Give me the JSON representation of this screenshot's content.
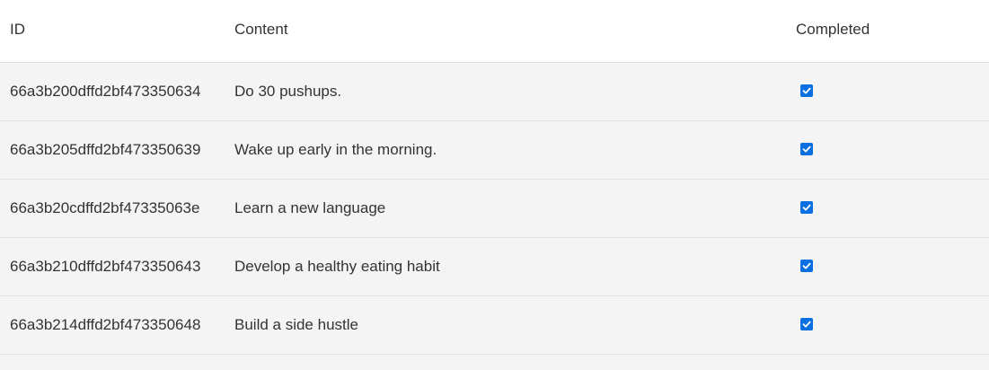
{
  "table": {
    "headers": {
      "id": "ID",
      "content": "Content",
      "completed": "Completed"
    },
    "rows": [
      {
        "id": "66a3b200dffd2bf473350634",
        "content": "Do 30 pushups.",
        "completed": true
      },
      {
        "id": "66a3b205dffd2bf473350639",
        "content": "Wake up early in the morning.",
        "completed": true
      },
      {
        "id": "66a3b20cdffd2bf47335063e",
        "content": "Learn a new language",
        "completed": true
      },
      {
        "id": "66a3b210dffd2bf473350643",
        "content": "Develop a healthy eating habit",
        "completed": true
      },
      {
        "id": "66a3b214dffd2bf473350648",
        "content": "Build a side hustle",
        "completed": true
      }
    ]
  },
  "icons": {
    "checkbox": "checkmark-icon"
  },
  "colors": {
    "checkbox_fill": "#0a6fe0",
    "row_background": "#f4f4f4",
    "header_background": "#ffffff"
  }
}
